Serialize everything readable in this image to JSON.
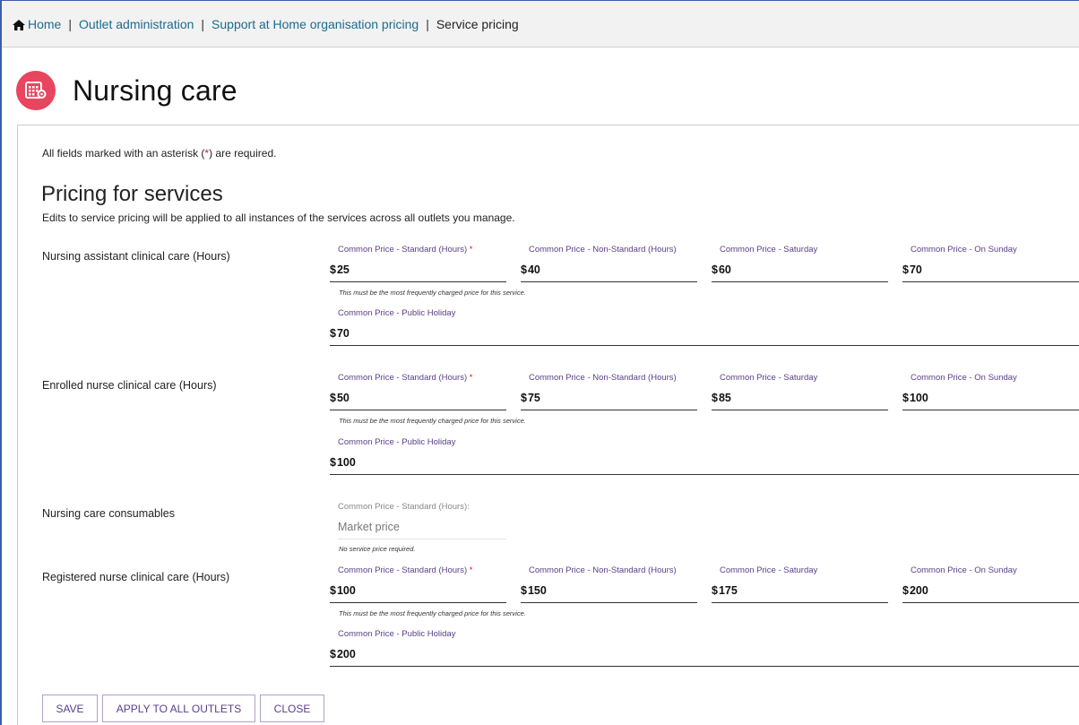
{
  "breadcrumb": {
    "home": "Home",
    "outlet_admin": "Outlet administration",
    "org_pricing": "Support at Home organisation pricing",
    "current": "Service pricing",
    "separator": "|"
  },
  "page": {
    "title": "Nursing care",
    "icon": "service-calendar-gear-icon",
    "accent_color": "#e8455f"
  },
  "form": {
    "required_note_prefix": "All fields marked with an asterisk (",
    "required_star": "*",
    "required_note_suffix": ") are required.",
    "section_title": "Pricing for services",
    "section_desc": "Edits to service pricing will be applied to all instances of the services across all outlets you manage."
  },
  "labels": {
    "standard": "Common Price - Standard (Hours)",
    "non_standard": "Common Price - Non-Standard (Hours)",
    "saturday": "Common Price - Saturday",
    "sunday": "Common Price - On Sunday",
    "public_holiday": "Common Price - Public Holiday",
    "standard_colon": "Common Price - Standard (Hours):",
    "star": "*",
    "currency": "$",
    "hint_frequent": "This must be the most frequently charged price for this service.",
    "hint_no_price": "No service price required."
  },
  "services": [
    {
      "name": "Nursing assistant clinical care (Hours)",
      "standard": "25",
      "non_standard": "40",
      "saturday": "60",
      "sunday": "70",
      "public_holiday": "70"
    },
    {
      "name": "Enrolled nurse clinical care (Hours)",
      "standard": "50",
      "non_standard": "75",
      "saturday": "85",
      "sunday": "100",
      "public_holiday": "100"
    },
    {
      "name": "Nursing care consumables",
      "standard": "Market price"
    },
    {
      "name": "Registered nurse clinical care (Hours)",
      "standard": "100",
      "non_standard": "150",
      "saturday": "175",
      "sunday": "200",
      "public_holiday": "200"
    }
  ],
  "buttons": {
    "save": "SAVE",
    "apply_all": "APPLY TO ALL OUTLETS",
    "close": "CLOSE"
  }
}
